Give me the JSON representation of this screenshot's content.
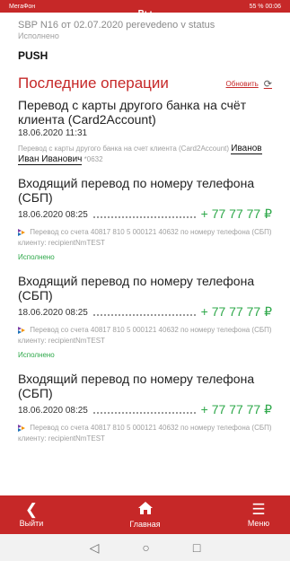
{
  "status_bar": {
    "left": "МегаФон ",
    "center": "Вы",
    "right": "55 % 00:06"
  },
  "top": {
    "line": "SBP N16 от 02.07.2020 perevedeno v status",
    "status": "Исполнено"
  },
  "push": "PUSH",
  "section": {
    "title": "Последние операции",
    "refresh_label": "Обновить",
    "refresh_icon": "refresh-icon"
  },
  "operations": [
    {
      "title": "Перевод с карты другого банка на счёт клиента (Card2Account)",
      "date": "18.06.2020 11:31",
      "desc": "Перевод с карты другого банка на счет клиента (Card2Account)",
      "name": "Иванов Иван Иванович",
      "suffix": " *0632"
    },
    {
      "title": "Входящий перевод по номеру телефона (СБП)",
      "date": "18.06.2020 08:25",
      "amount": "+ 77 77 77 ₽",
      "desc": "Перевод со счета 40817 810 5 000121 40632 по номеру телефона (СБП) клиенту: recipientNmTEST",
      "status": "Исполнено"
    },
    {
      "title": "Входящий перевод по номеру телефона (СБП)",
      "date": "18.06.2020 08:25",
      "amount": "+ 77 77 77 ₽",
      "desc": "Перевод со счета 40817 810 5 000121 40632 по номеру телефона (СБП) клиенту: recipientNmTEST",
      "status": "Исполнено"
    },
    {
      "title": "Входящий перевод по номеру телефона (СБП)",
      "date": "18.06.2020 08:25",
      "amount": "+ 77 77 77 ₽",
      "desc": "Перевод со счета 40817 810 5 000121 40632 по номеру телефона (СБП) клиенту: recipientNmTEST"
    }
  ],
  "nav": {
    "exit": {
      "label": "Выйти",
      "icon": "chevron-left-icon"
    },
    "home": {
      "label": "Главная",
      "icon": "home-icon"
    },
    "menu": {
      "label": "Меню",
      "icon": "menu-icon"
    }
  },
  "android": {
    "back": "◁",
    "home": "○",
    "recent": "□"
  },
  "colors": {
    "accent": "#c62828",
    "amount": "#2ea84a",
    "muted": "#a0a0a0"
  }
}
